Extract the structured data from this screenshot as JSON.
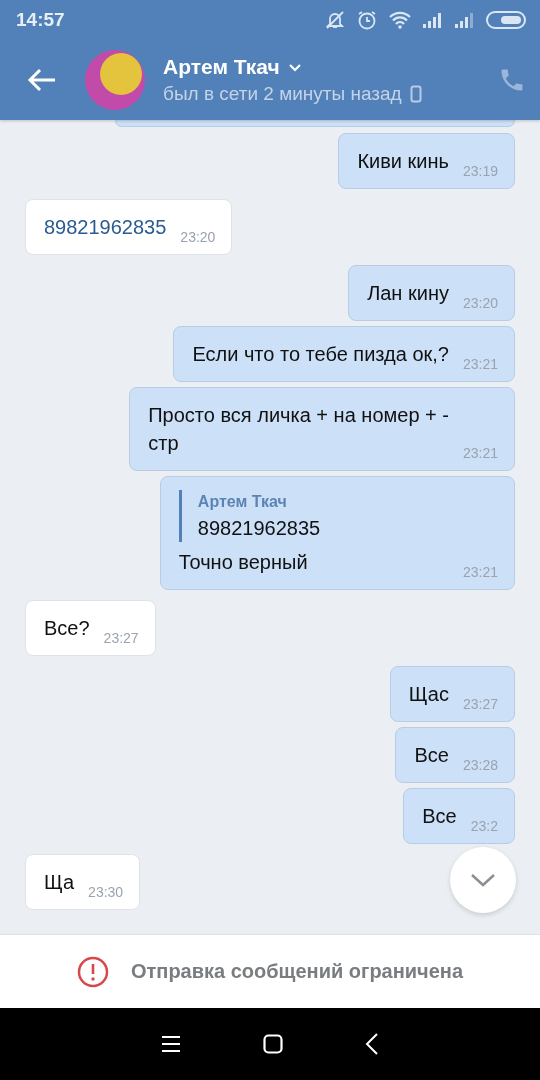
{
  "status_bar": {
    "time": "14:57"
  },
  "header": {
    "name": "Артем Ткач",
    "status": "был в сети 2 минуты назад"
  },
  "messages": [
    {
      "outgoing": true,
      "kind": "text",
      "text": "Киви кинь",
      "time": "23:19"
    },
    {
      "outgoing": false,
      "kind": "link",
      "text": "89821962835",
      "time": "23:20"
    },
    {
      "outgoing": true,
      "kind": "text",
      "text": "Лан кину",
      "time": "23:20"
    },
    {
      "outgoing": true,
      "kind": "text",
      "text": "Если что то тебе пизда ок,?",
      "time": "23:21"
    },
    {
      "outgoing": true,
      "kind": "text",
      "text": "Просто вся личка + на номер + -\nстр",
      "time": "23:21"
    },
    {
      "outgoing": true,
      "kind": "reply",
      "reply": {
        "author": "Артем Ткач",
        "text": "89821962835"
      },
      "text": "Точно верный",
      "time": "23:21"
    },
    {
      "outgoing": false,
      "kind": "text",
      "text": "Все?",
      "time": "23:27"
    },
    {
      "outgoing": true,
      "kind": "text",
      "text": "Щас",
      "time": "23:27"
    },
    {
      "outgoing": true,
      "kind": "text",
      "text": "Все",
      "time": "23:28"
    },
    {
      "outgoing": true,
      "kind": "text",
      "text": "Все",
      "time": "23:2"
    },
    {
      "outgoing": false,
      "kind": "text",
      "text": "Ща",
      "time": "23:30"
    }
  ],
  "notice": {
    "text": "Отправка сообщений ограничена"
  }
}
